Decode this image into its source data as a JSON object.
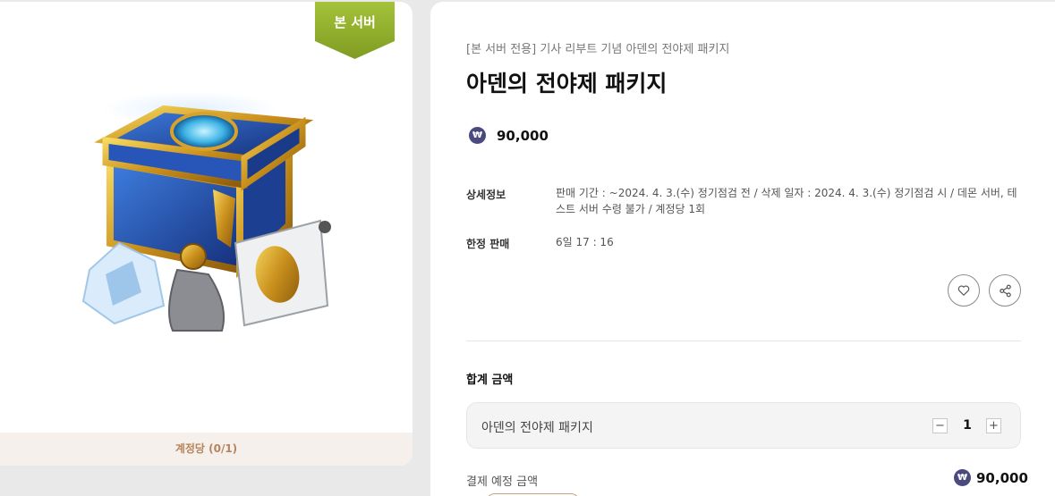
{
  "badge": {
    "label": "본 서버",
    "color": "#8fad2c"
  },
  "product": {
    "subtitle": "[본 서버 전용] 기사 리부트 기념 아덴의 전야제 패키지",
    "title": "아덴의 전야제 패키지",
    "currency_icon": "won-coin-icon",
    "currency_symbol": "₩",
    "price": "90,000",
    "account_limit": "계정당 (0/1)"
  },
  "details": {
    "info_label": "상세정보",
    "info_value": "판매 기간 : ~2024. 4. 3.(수) 정기점검 전 / 삭제 일자 : 2024. 4. 3.(수) 정기점검 시 / 데몬 서버, 테스트 서버 수령 불가 / 계정당 1회",
    "limited_label": "한정 판매",
    "limited_value": "6일 17 : 16"
  },
  "actions": {
    "wishlist_icon": "heart-icon",
    "share_icon": "share-icon"
  },
  "total": {
    "label": "합계 금액",
    "item_name": "아덴의 전야제 패키지",
    "quantity": "1",
    "minus": "−",
    "plus": "+"
  },
  "payment": {
    "label": "결제 예정 금액",
    "amount": "90,000"
  },
  "colors": {
    "accent_won": "#4b4a7e",
    "limit_text": "#b8845b",
    "badge_green": "#8fad2c"
  }
}
